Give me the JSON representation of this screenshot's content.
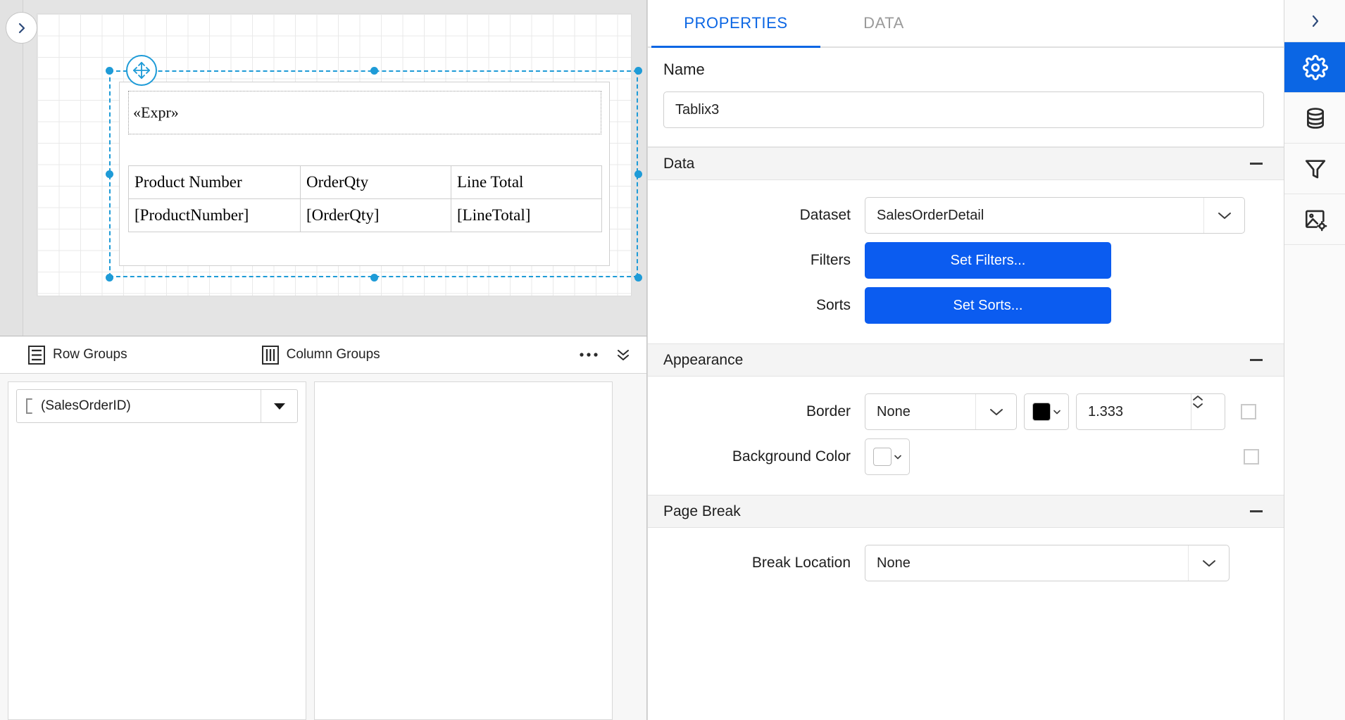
{
  "design_surface": {
    "expander_icon": "chevron-right-icon",
    "move_handle_icon": "move-arrows-icon",
    "expression_placeholder": "«Expr»",
    "tablix": {
      "headers": [
        "Product Number",
        "OrderQty",
        "Line Total"
      ],
      "detail_row": [
        "[ProductNumber]",
        "[OrderQty]",
        "[LineTotal]"
      ]
    }
  },
  "groups_panel": {
    "row_groups_label": "Row Groups",
    "row_groups_icon": "rows-icon",
    "column_groups_label": "Column Groups",
    "column_groups_icon": "columns-icon",
    "more_icon": "ellipsis-icon",
    "collapse_icon": "double-chevron-down-icon",
    "row_group_items": [
      {
        "label": "(SalesOrderID)",
        "icon": "bracket-icon",
        "caret_icon": "caret-down-icon"
      }
    ],
    "column_group_items": []
  },
  "properties_panel": {
    "tabs": [
      {
        "label": "PROPERTIES",
        "active": true
      },
      {
        "label": "DATA",
        "active": false
      }
    ],
    "name": {
      "label": "Name",
      "value": "Tablix3",
      "placeholder": "Name"
    },
    "sections": [
      {
        "title": "Data",
        "collapse_icon": "minus-icon",
        "rows": [
          {
            "label": "Dataset",
            "type": "select",
            "value": "SalesOrderDetail",
            "caret_icon": "chevron-down-icon"
          },
          {
            "label": "Filters",
            "type": "button",
            "value": "Set Filters..."
          },
          {
            "label": "Sorts",
            "type": "button",
            "value": "Set Sorts..."
          }
        ]
      },
      {
        "title": "Appearance",
        "collapse_icon": "minus-icon",
        "rows": [
          {
            "label": "Border",
            "type": "border",
            "style_value": "None",
            "color_value": "#000000",
            "width_value": "1.333",
            "caret_icon": "chevron-down-icon",
            "spin_up_icon": "chevron-up-icon",
            "spin_down_icon": "chevron-down-icon",
            "checkbox_checked": false
          },
          {
            "label": "Background Color",
            "type": "color",
            "color_value": "#ffffff",
            "caret_icon": "chevron-down-icon",
            "checkbox_checked": false
          }
        ]
      },
      {
        "title": "Page Break",
        "collapse_icon": "minus-icon",
        "rows": [
          {
            "label": "Break Location",
            "type": "select",
            "value": "None",
            "caret_icon": "chevron-down-icon"
          }
        ]
      }
    ]
  },
  "icon_rail": {
    "items": [
      {
        "name": "expand-panel-icon",
        "active": false
      },
      {
        "name": "gear-icon",
        "active": true
      },
      {
        "name": "database-icon",
        "active": false
      },
      {
        "name": "filter-icon",
        "active": false
      },
      {
        "name": "image-settings-icon",
        "active": false
      }
    ]
  },
  "colors": {
    "accent": "#0b66e4",
    "button_blue": "#0b5cf0",
    "selection_blue": "#1e9bd7",
    "canvas_gray": "#e2e2e2",
    "section_gray": "#f4f4f4"
  }
}
